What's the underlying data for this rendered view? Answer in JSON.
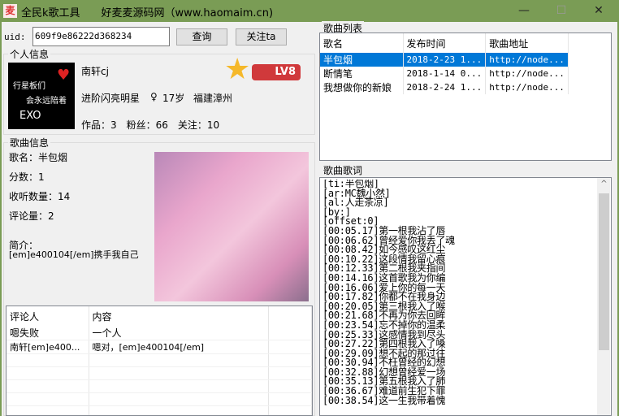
{
  "window": {
    "title": "全民k歌工具　　好麦麦源码网（www.haomaim.cn)",
    "icon": "麦",
    "minimize": "—",
    "maximize": "☐",
    "close": "✕"
  },
  "query": {
    "uid_label": "uid:",
    "uid_value": "609f9e86222d368234",
    "search_button": "查询",
    "follow_button": "关注ta"
  },
  "profile": {
    "group_label": "个人信息",
    "avatar_text": [
      "行星板们",
      "会永远陪着",
      "EXO"
    ],
    "name": "南轩cj",
    "level_badge": "LV8",
    "title": "进阶闪亮明星",
    "gender": "♀",
    "age": "17岁",
    "location": "福建漳州",
    "stats": "作品：3　粉丝：66　关注：10"
  },
  "song_info": {
    "group_label": "歌曲信息",
    "name": "歌名：半包烟",
    "score": "分数：1",
    "listens": "收听数量：14",
    "comments": "评论量：2",
    "intro_label": "简介：",
    "intro": "[em]e400104[/em]携手我自己"
  },
  "comments": {
    "headers": [
      "评论人",
      "内容"
    ],
    "rows": [
      [
        "嗯失败",
        "一个人"
      ],
      [
        "南轩[em]e400...",
        "嗯对，[em]e400104[/em]"
      ]
    ]
  },
  "song_list": {
    "group_label": "歌曲列表",
    "headers": [
      "歌名",
      "发布时间",
      "歌曲地址"
    ],
    "rows": [
      [
        "半包烟",
        "2018-2-23 1...",
        "http://node..."
      ],
      [
        "断情笔",
        "2018-1-14 0...",
        "http://node..."
      ],
      [
        "我想做你的新娘",
        "2018-2-24 1...",
        "http://node..."
      ]
    ],
    "selected_index": 0
  },
  "lyrics": {
    "group_label": "歌曲歌词",
    "text": "[ti:半包烟]\n[ar:MC魏小然]\n[al:人走茶凉]\n[by:]\n[offset:0]\n[00:05.17]第一根我沾了唇\n[00:06.62]曾经爱你我丢了魂\n[00:08.42]如今感叹这红尘\n[00:10.22]这段情我留心痕\n[00:12.33]第二根我夹指间\n[00:14.16]这首歌我为你编\n[00:16.06]爱上你的每一天\n[00:17.82]你都不在我身边\n[00:20.05]第三根我入了喉\n[00:21.68]不再为你去回眸\n[00:23.54]忘不掉你的温柔\n[00:25.33]这感情我到尽头\n[00:27.22]第四根我入了嗓\n[00:29.09]想不起的那过往\n[00:30.94]不枉曾经的幻想\n[00:32.88]幻想曾经爱一场\n[00:35.13]第五根我入了肺\n[00:36.67]难道前生犯下罪\n[00:38.54]这一生我带着愧",
    "scroll_up": "^"
  }
}
